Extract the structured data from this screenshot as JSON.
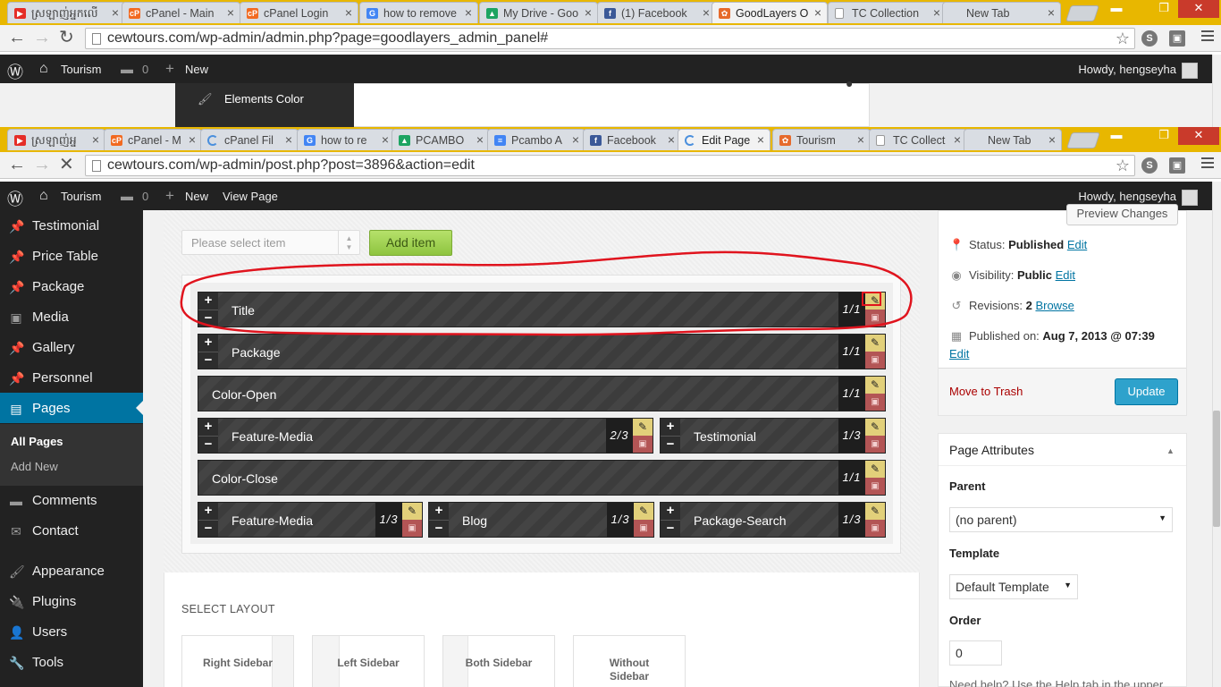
{
  "back_window": {
    "tabs": [
      {
        "title": "ស្រឡាញ់អ្នកលើ",
        "fav": "youtube",
        "color": "#e52d27"
      },
      {
        "title": "cPanel - Main",
        "fav": "cpanel",
        "color": "#f26a21"
      },
      {
        "title": "cPanel Login",
        "fav": "cpanel",
        "color": "#f26a21"
      },
      {
        "title": "how to remove",
        "fav": "google",
        "color": "#4285f4"
      },
      {
        "title": "My Drive - Goo",
        "fav": "drive",
        "color": "#1da462"
      },
      {
        "title": "(1) Facebook",
        "fav": "facebook",
        "color": "#3b5998"
      },
      {
        "title": "GoodLayers O",
        "fav": "goodlayers",
        "color": "#e66a2c"
      },
      {
        "title": "TC Collection",
        "fav": "page",
        "color": "#999999"
      },
      {
        "title": "New Tab",
        "fav": "none",
        "color": "#999999"
      }
    ],
    "url": "cewtours.com/wp-admin/admin.php?page=goodlayers_admin_panel#",
    "adminbar": {
      "site": "Tourism",
      "comments": "0",
      "new": "New",
      "howdy": "Howdy, hengseyha"
    },
    "menu_item": "Elements Color"
  },
  "front_window": {
    "tabs": [
      {
        "title": "ស្រឡាញ់អ្ន",
        "fav": "youtube",
        "color": "#e52d27"
      },
      {
        "title": "cPanel - M",
        "fav": "cpanel",
        "color": "#f26a21"
      },
      {
        "title": "cPanel Fil",
        "fav": "loading",
        "color": "#4a8fdd"
      },
      {
        "title": "how to re",
        "fav": "google",
        "color": "#4285f4"
      },
      {
        "title": "PCAMBO",
        "fav": "drive",
        "color": "#1da462"
      },
      {
        "title": "Pcambo A",
        "fav": "docs",
        "color": "#4285f4"
      },
      {
        "title": "Facebook",
        "fav": "facebook",
        "color": "#3b5998"
      },
      {
        "title": "Edit Page",
        "fav": "loading",
        "color": "#4a8fdd"
      },
      {
        "title": "Tourism",
        "fav": "goodlayers",
        "color": "#e66a2c"
      },
      {
        "title": "TC Collect",
        "fav": "page",
        "color": "#999999"
      },
      {
        "title": "New Tab",
        "fav": "none",
        "color": "#999999"
      }
    ],
    "url": "cewtours.com/wp-admin/post.php?post=3896&action=edit",
    "adminbar": {
      "site": "Tourism",
      "comments": "0",
      "new": "New",
      "view": "View Page",
      "howdy": "Howdy, hengseyha"
    }
  },
  "sidebar": {
    "items": [
      {
        "label": "Testimonial",
        "icon": "pin-icon",
        "glyph": "📌"
      },
      {
        "label": "Price Table",
        "icon": "pin-icon",
        "glyph": "📌"
      },
      {
        "label": "Package",
        "icon": "pin-icon",
        "glyph": "📌"
      },
      {
        "label": "Media",
        "icon": "media-icon",
        "glyph": "▣"
      },
      {
        "label": "Gallery",
        "icon": "pin-icon",
        "glyph": "📌"
      },
      {
        "label": "Personnel",
        "icon": "pin-icon",
        "glyph": "📌"
      },
      {
        "label": "Pages",
        "icon": "pages-icon",
        "glyph": "▤"
      },
      {
        "label": "Comments",
        "icon": "comments-icon",
        "glyph": "▬"
      },
      {
        "label": "Contact",
        "icon": "mail-icon",
        "glyph": "✉"
      },
      {
        "label": "Appearance",
        "icon": "brush-icon",
        "glyph": "🖌"
      },
      {
        "label": "Plugins",
        "icon": "plug-icon",
        "glyph": "🔌"
      },
      {
        "label": "Users",
        "icon": "user-icon",
        "glyph": "👤"
      },
      {
        "label": "Tools",
        "icon": "wrench-icon",
        "glyph": "🔧"
      }
    ],
    "sub": {
      "all_pages": "All Pages",
      "add_new": "Add New"
    }
  },
  "builder": {
    "select_placeholder": "Please select item",
    "add_button": "Add item",
    "rows": [
      [
        {
          "label": "Title",
          "size": "1/1",
          "pm": true
        }
      ],
      [
        {
          "label": "Package",
          "size": "1/1",
          "pm": true
        }
      ],
      [
        {
          "label": "Color-Open",
          "size": "1/1",
          "pm": false
        }
      ],
      [
        {
          "label": "Feature-Media",
          "size": "2/3",
          "pm": true
        },
        {
          "label": "Testimonial",
          "size": "1/3",
          "pm": true
        }
      ],
      [
        {
          "label": "Color-Close",
          "size": "1/1",
          "pm": false
        }
      ],
      [
        {
          "label": "Feature-Media",
          "size": "1/3",
          "pm": true
        },
        {
          "label": "Blog",
          "size": "1/3",
          "pm": true
        },
        {
          "label": "Package-Search",
          "size": "1/3",
          "pm": true
        }
      ]
    ],
    "select_layout": "SELECT LAYOUT",
    "layouts": [
      "Right Sidebar",
      "Left Sidebar",
      "Both Sidebar",
      "Without Sidebar"
    ]
  },
  "publish": {
    "preview": "Preview Changes",
    "status_label": "Status:",
    "status_value": "Published",
    "visibility_label": "Visibility:",
    "visibility_value": "Public",
    "revisions_label": "Revisions:",
    "revisions_value": "2",
    "browse": "Browse",
    "published_label": "Published on:",
    "published_value": "Aug 7, 2013 @ 07:39",
    "edit": "Edit",
    "trash": "Move to Trash",
    "update": "Update"
  },
  "attributes": {
    "title": "Page Attributes",
    "parent_label": "Parent",
    "parent_value": "(no parent)",
    "template_label": "Template",
    "template_value": "Default Template",
    "order_label": "Order",
    "order_value": "0",
    "help": "Need help? Use the Help tab in the upper"
  },
  "colors": {
    "wp_blue": "#0074a2",
    "annotation": "#e0141e",
    "add_green": "#8ec43f"
  }
}
